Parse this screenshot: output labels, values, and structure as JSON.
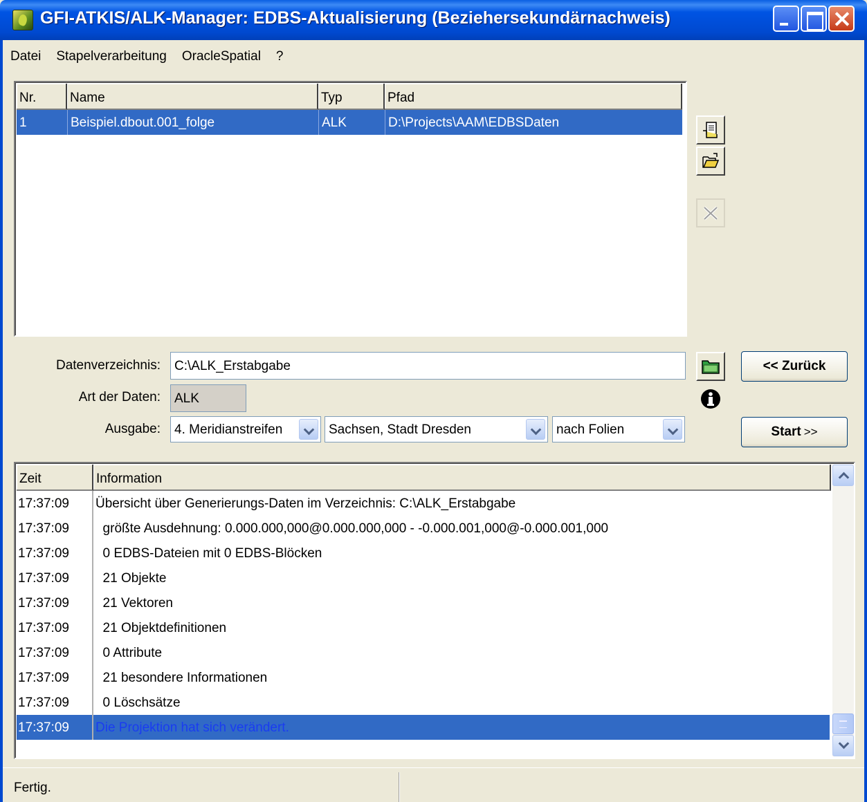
{
  "window": {
    "title": "GFI-ATKIS/ALK-Manager: EDBS-Aktualisierung (Beziehersekundärnachweis)"
  },
  "menu": [
    "Datei",
    "Stapelverarbeitung",
    "OracleSpatial",
    "?"
  ],
  "files": {
    "headers": [
      "Nr.",
      "Name",
      "Typ",
      "Pfad"
    ],
    "rows": [
      {
        "nr": "1",
        "name": "Beispiel.dbout.001_folge",
        "typ": "ALK",
        "pfad": "D:\\Projects\\AAM\\EDBSDaten"
      }
    ]
  },
  "form": {
    "datenverzeichnis_label": "Datenverzeichnis:",
    "datenverzeichnis_value": "C:\\ALK_Erstabgabe",
    "art_label": "Art der Daten:",
    "art_value": "ALK",
    "ausgabe_label": "Ausgabe:",
    "ausgabe_1": "4. Meridianstreifen",
    "ausgabe_2": "Sachsen, Stadt Dresden",
    "ausgabe_3": "nach Folien"
  },
  "buttons": {
    "back": "<< Zurück",
    "start": "Start",
    "start_suffix": ">>"
  },
  "log": {
    "headers": [
      "Zeit",
      "Information"
    ],
    "rows": [
      {
        "zeit": "17:37:09",
        "info": "Übersicht über Generierungs-Daten im Verzeichnis: C:\\ALK_Erstabgabe"
      },
      {
        "zeit": "17:37:09",
        "info": "  größte Ausdehnung: 0.000.000,000@0.000.000,000 - -0.000.001,000@-0.000.001,000"
      },
      {
        "zeit": "17:37:09",
        "info": "  0 EDBS-Dateien mit 0 EDBS-Blöcken"
      },
      {
        "zeit": "17:37:09",
        "info": "  21 Objekte"
      },
      {
        "zeit": "17:37:09",
        "info": "  21 Vektoren"
      },
      {
        "zeit": "17:37:09",
        "info": "  21 Objektdefinitionen"
      },
      {
        "zeit": "17:37:09",
        "info": "  0 Attribute"
      },
      {
        "zeit": "17:37:09",
        "info": "  21 besondere Informationen"
      },
      {
        "zeit": "17:37:09",
        "info": "  0 Löschsätze"
      },
      {
        "zeit": "17:37:09",
        "info": "Die Projektion hat sich verändert."
      }
    ],
    "selected_row": 9
  },
  "status": {
    "text": "Fertig."
  }
}
